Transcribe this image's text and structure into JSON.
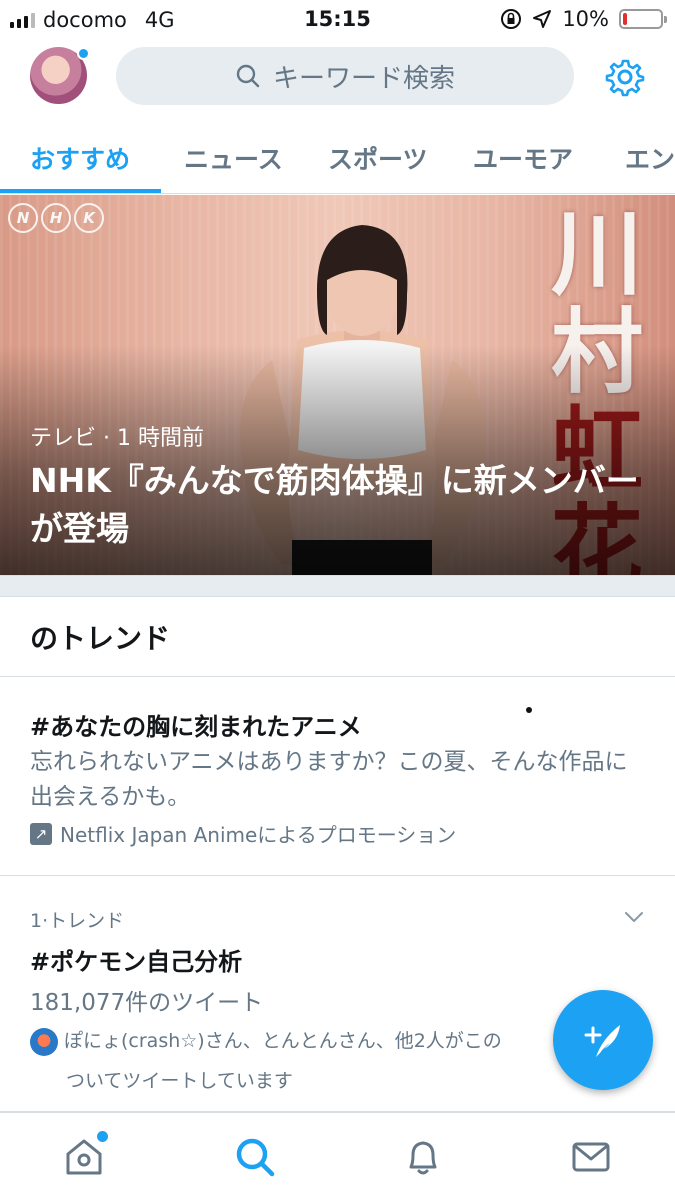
{
  "status_bar": {
    "carrier": "docomo",
    "network": "4G",
    "time": "15:15",
    "battery_text": "10%",
    "battery_level": 0.1
  },
  "header": {
    "search_placeholder": "キーワード検索"
  },
  "tabs": [
    {
      "label": "おすすめ",
      "active": true
    },
    {
      "label": "ニュース",
      "active": false
    },
    {
      "label": "スポーツ",
      "active": false
    },
    {
      "label": "ユーモア",
      "active": false
    },
    {
      "label": "エン",
      "active": false
    }
  ],
  "hero": {
    "meta": "テレビ · 1 時間前",
    "title": "NHK『みんなで筋肉体操』に新メンバーが登場",
    "logo_letters": [
      "N",
      "H",
      "K"
    ],
    "kanji_white": [
      "川",
      "村"
    ],
    "kanji_red": [
      "虹",
      "花"
    ]
  },
  "trends_header": "のトレンド",
  "promoted": {
    "title": "#あなたの胸に刻まれたアニメ",
    "description": "忘れられないアニメはありますか？この夏、そんな作品に出会えるかも。",
    "promoted_by": "Netflix Japan Animeによるプロモーション"
  },
  "trend_1": {
    "rank_label": "1·トレンド",
    "name": "#ポケモン自己分析",
    "tweet_count": "181,077件のツイート",
    "context_line1": "ぽにょ(crash☆)さん、とんとんさん、他2人がこの",
    "context_line2": "ついてツイートしています"
  },
  "colors": {
    "accent": "#1da1f2",
    "secondary_text": "#657786",
    "divider": "#d8dee2",
    "battery_low": "#e0312e"
  },
  "icons": {
    "settings": "gear-icon",
    "search": "search-icon",
    "home": "home-icon",
    "notifications": "bell-icon",
    "messages": "mail-icon",
    "compose": "compose-tweet-icon"
  }
}
